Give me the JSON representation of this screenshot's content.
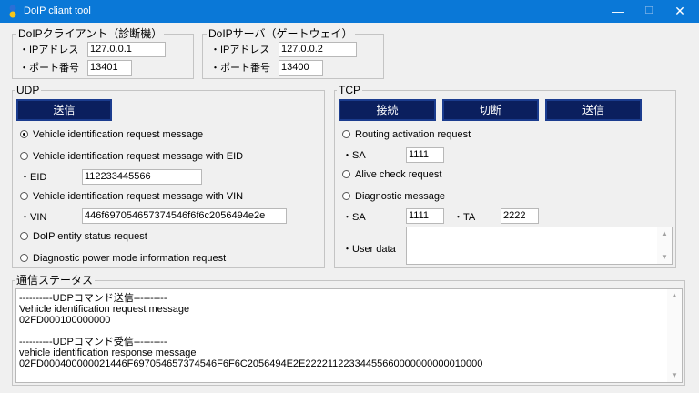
{
  "window": {
    "title": "DoIP cliant tool",
    "minimize_glyph": "—",
    "maximize_glyph": "☐",
    "close_glyph": "✕"
  },
  "client_group": {
    "title": "DoIPクライアント（診断機）",
    "ip_label": "・IPアドレス",
    "ip_value": "127.0.0.1",
    "port_label": "・ポート番号",
    "port_value": "13401"
  },
  "server_group": {
    "title": "DoIPサーバ（ゲートウェイ）",
    "ip_label": "・IPアドレス",
    "ip_value": "127.0.0.2",
    "port_label": "・ポート番号",
    "port_value": "13400"
  },
  "udp": {
    "title": "UDP",
    "send_label": "送信",
    "options": [
      "Vehicle identification request message",
      "Vehicle identification request message with EID",
      "Vehicle identification request message with VIN",
      "DoIP entity status request",
      "Diagnostic power mode information request"
    ],
    "selected_index": 0,
    "eid_label": "・EID",
    "eid_value": "112233445566",
    "vin_label": "・VIN",
    "vin_value": "446f697054657374546f6f6c2056494e2e"
  },
  "tcp": {
    "title": "TCP",
    "connect_label": "接続",
    "disconnect_label": "切断",
    "send_label": "送信",
    "routing_label": "Routing activation request",
    "routing_sa_label": "・SA",
    "routing_sa_value": "1111",
    "alive_label": "Alive check request",
    "diag_label": "Diagnostic message",
    "diag_sa_label": "・SA",
    "diag_sa_value": "1111",
    "diag_ta_label": "・TA",
    "diag_ta_value": "2222",
    "user_data_label": "・User data",
    "user_data_value": ""
  },
  "status": {
    "title": "通信ステータス",
    "lines": [
      "----------UDPコマンド送信----------",
      "Vehicle identification request message",
      "02FD000100000000",
      "",
      "----------UDPコマンド受信----------",
      "vehicle identification response message",
      "02FD000400000021446F697054657374546F6F6C2056494E2E22221122334455660000000000010000"
    ]
  },
  "colors": {
    "titlebar": "#0a78d7",
    "button_bg": "#0b1f5e",
    "button_border": "#1b3c8e",
    "window_bg": "#f0f0f0"
  },
  "icons": {
    "app": "app-icon",
    "scroll_up": "scroll-up-icon",
    "scroll_down": "scroll-down-icon"
  }
}
